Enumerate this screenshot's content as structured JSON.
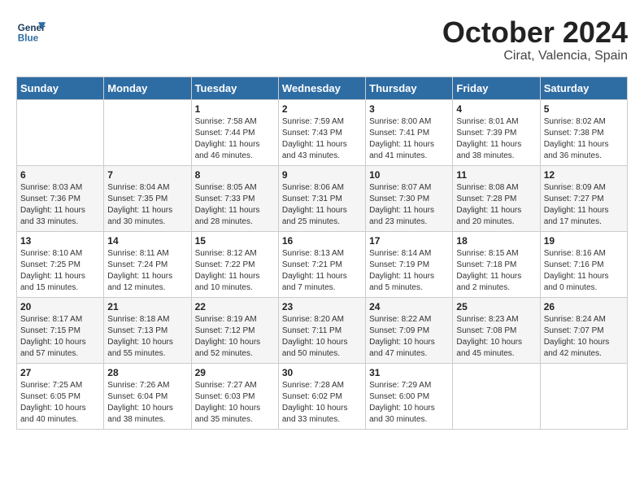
{
  "header": {
    "logo_line1": "General",
    "logo_line2": "Blue",
    "month_title": "October 2024",
    "location": "Cirat, Valencia, Spain"
  },
  "days_of_week": [
    "Sunday",
    "Monday",
    "Tuesday",
    "Wednesday",
    "Thursday",
    "Friday",
    "Saturday"
  ],
  "weeks": [
    [
      {
        "day": "",
        "info": ""
      },
      {
        "day": "",
        "info": ""
      },
      {
        "day": "1",
        "info": "Sunrise: 7:58 AM\nSunset: 7:44 PM\nDaylight: 11 hours and 46 minutes."
      },
      {
        "day": "2",
        "info": "Sunrise: 7:59 AM\nSunset: 7:43 PM\nDaylight: 11 hours and 43 minutes."
      },
      {
        "day": "3",
        "info": "Sunrise: 8:00 AM\nSunset: 7:41 PM\nDaylight: 11 hours and 41 minutes."
      },
      {
        "day": "4",
        "info": "Sunrise: 8:01 AM\nSunset: 7:39 PM\nDaylight: 11 hours and 38 minutes."
      },
      {
        "day": "5",
        "info": "Sunrise: 8:02 AM\nSunset: 7:38 PM\nDaylight: 11 hours and 36 minutes."
      }
    ],
    [
      {
        "day": "6",
        "info": "Sunrise: 8:03 AM\nSunset: 7:36 PM\nDaylight: 11 hours and 33 minutes."
      },
      {
        "day": "7",
        "info": "Sunrise: 8:04 AM\nSunset: 7:35 PM\nDaylight: 11 hours and 30 minutes."
      },
      {
        "day": "8",
        "info": "Sunrise: 8:05 AM\nSunset: 7:33 PM\nDaylight: 11 hours and 28 minutes."
      },
      {
        "day": "9",
        "info": "Sunrise: 8:06 AM\nSunset: 7:31 PM\nDaylight: 11 hours and 25 minutes."
      },
      {
        "day": "10",
        "info": "Sunrise: 8:07 AM\nSunset: 7:30 PM\nDaylight: 11 hours and 23 minutes."
      },
      {
        "day": "11",
        "info": "Sunrise: 8:08 AM\nSunset: 7:28 PM\nDaylight: 11 hours and 20 minutes."
      },
      {
        "day": "12",
        "info": "Sunrise: 8:09 AM\nSunset: 7:27 PM\nDaylight: 11 hours and 17 minutes."
      }
    ],
    [
      {
        "day": "13",
        "info": "Sunrise: 8:10 AM\nSunset: 7:25 PM\nDaylight: 11 hours and 15 minutes."
      },
      {
        "day": "14",
        "info": "Sunrise: 8:11 AM\nSunset: 7:24 PM\nDaylight: 11 hours and 12 minutes."
      },
      {
        "day": "15",
        "info": "Sunrise: 8:12 AM\nSunset: 7:22 PM\nDaylight: 11 hours and 10 minutes."
      },
      {
        "day": "16",
        "info": "Sunrise: 8:13 AM\nSunset: 7:21 PM\nDaylight: 11 hours and 7 minutes."
      },
      {
        "day": "17",
        "info": "Sunrise: 8:14 AM\nSunset: 7:19 PM\nDaylight: 11 hours and 5 minutes."
      },
      {
        "day": "18",
        "info": "Sunrise: 8:15 AM\nSunset: 7:18 PM\nDaylight: 11 hours and 2 minutes."
      },
      {
        "day": "19",
        "info": "Sunrise: 8:16 AM\nSunset: 7:16 PM\nDaylight: 11 hours and 0 minutes."
      }
    ],
    [
      {
        "day": "20",
        "info": "Sunrise: 8:17 AM\nSunset: 7:15 PM\nDaylight: 10 hours and 57 minutes."
      },
      {
        "day": "21",
        "info": "Sunrise: 8:18 AM\nSunset: 7:13 PM\nDaylight: 10 hours and 55 minutes."
      },
      {
        "day": "22",
        "info": "Sunrise: 8:19 AM\nSunset: 7:12 PM\nDaylight: 10 hours and 52 minutes."
      },
      {
        "day": "23",
        "info": "Sunrise: 8:20 AM\nSunset: 7:11 PM\nDaylight: 10 hours and 50 minutes."
      },
      {
        "day": "24",
        "info": "Sunrise: 8:22 AM\nSunset: 7:09 PM\nDaylight: 10 hours and 47 minutes."
      },
      {
        "day": "25",
        "info": "Sunrise: 8:23 AM\nSunset: 7:08 PM\nDaylight: 10 hours and 45 minutes."
      },
      {
        "day": "26",
        "info": "Sunrise: 8:24 AM\nSunset: 7:07 PM\nDaylight: 10 hours and 42 minutes."
      }
    ],
    [
      {
        "day": "27",
        "info": "Sunrise: 7:25 AM\nSunset: 6:05 PM\nDaylight: 10 hours and 40 minutes."
      },
      {
        "day": "28",
        "info": "Sunrise: 7:26 AM\nSunset: 6:04 PM\nDaylight: 10 hours and 38 minutes."
      },
      {
        "day": "29",
        "info": "Sunrise: 7:27 AM\nSunset: 6:03 PM\nDaylight: 10 hours and 35 minutes."
      },
      {
        "day": "30",
        "info": "Sunrise: 7:28 AM\nSunset: 6:02 PM\nDaylight: 10 hours and 33 minutes."
      },
      {
        "day": "31",
        "info": "Sunrise: 7:29 AM\nSunset: 6:00 PM\nDaylight: 10 hours and 30 minutes."
      },
      {
        "day": "",
        "info": ""
      },
      {
        "day": "",
        "info": ""
      }
    ]
  ]
}
